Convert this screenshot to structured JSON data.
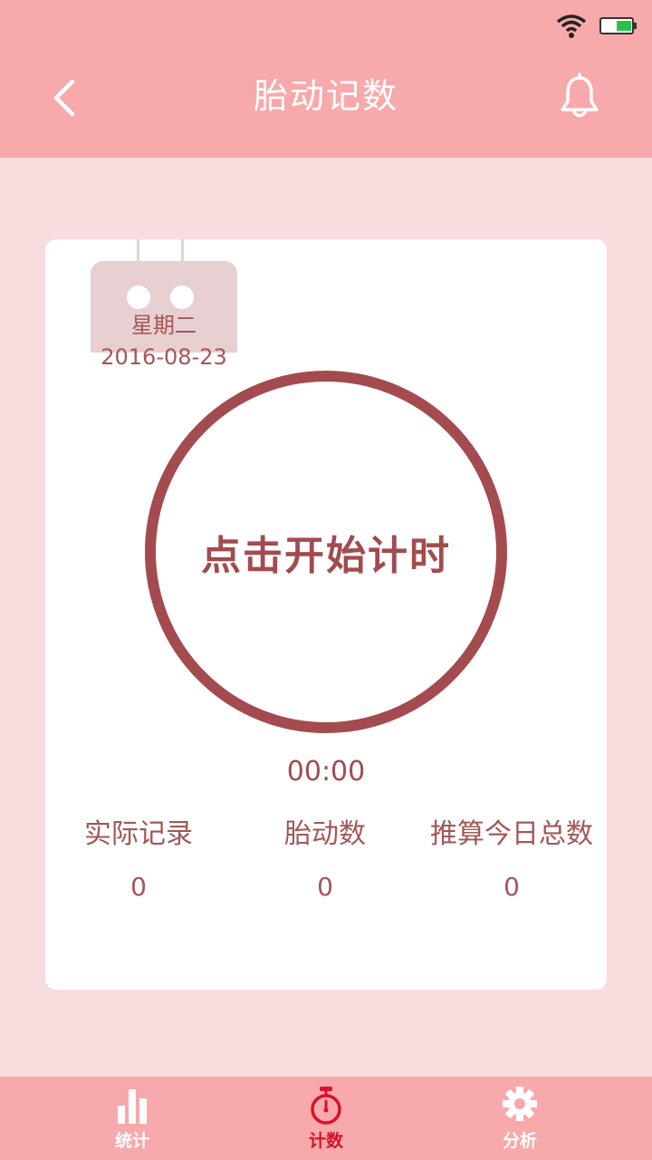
{
  "header": {
    "title": "胎动记数"
  },
  "calendar": {
    "weekday": "星期二",
    "date": "2016-08-23"
  },
  "timer": {
    "start_label": "点击开始计时",
    "elapsed": "00:00"
  },
  "stats": [
    {
      "label": "实际记录",
      "value": "0"
    },
    {
      "label": "胎动数",
      "value": "0"
    },
    {
      "label": "推算今日总数",
      "value": "0"
    }
  ],
  "tabs": [
    {
      "label": "统计",
      "icon": "bar-chart-icon",
      "active": false
    },
    {
      "label": "计数",
      "icon": "stopwatch-icon",
      "active": true
    },
    {
      "label": "分析",
      "icon": "gear-icon",
      "active": false
    }
  ],
  "colors": {
    "header_bg": "#f7a9ab",
    "page_bg": "#f9dcdd",
    "accent": "#a34b4f",
    "active_tab": "#d9112a"
  }
}
